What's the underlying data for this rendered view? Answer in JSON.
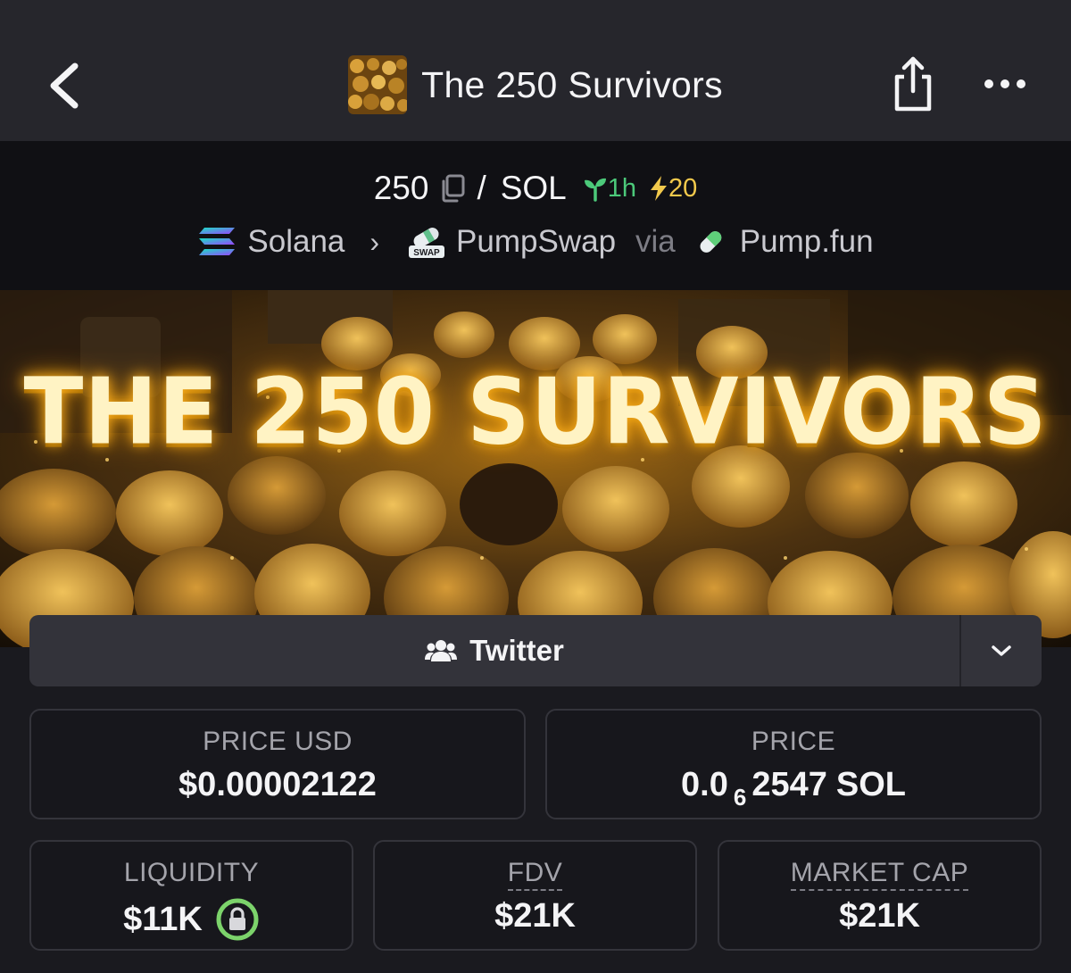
{
  "nav": {
    "title": "The 250 Survivors"
  },
  "pair": {
    "base": "250",
    "separator": "/",
    "quote": "SOL",
    "age": "1h",
    "boosts": "20"
  },
  "chain": {
    "network": "Solana",
    "dex": "PumpSwap",
    "via_label": "via",
    "launchpad": "Pump.fun",
    "swap_badge": "SWAP"
  },
  "banner": {
    "text": "THE 250 SURVIVORS"
  },
  "socials": {
    "twitter_label": "Twitter"
  },
  "stats": {
    "price_usd": {
      "label": "PRICE USD",
      "value": "$0.00002122"
    },
    "price": {
      "label": "PRICE",
      "prefix": "0.0",
      "zeros": "6",
      "digits": "2547",
      "unit": "SOL"
    },
    "liquidity": {
      "label": "LIQUIDITY",
      "value": "$11K"
    },
    "fdv": {
      "label": "FDV",
      "value": "$21K"
    },
    "market_cap": {
      "label": "MARKET CAP",
      "value": "$21K"
    }
  },
  "colors": {
    "nav_bg": "#26262c",
    "header_bg": "#101014",
    "content_bg": "#1a1a1f",
    "age_green": "#4cc97a",
    "boost_yellow": "#f2c94c",
    "lock_green": "#7cd36b"
  },
  "icons": {
    "back": "chevron-left-icon",
    "share": "share-icon",
    "more": "more-horizontal-icon",
    "copy": "copy-icon",
    "age": "seedling-icon",
    "boost": "lightning-icon",
    "twitter": "users-icon",
    "dropdown": "chevron-down-icon",
    "lock": "lock-icon"
  }
}
